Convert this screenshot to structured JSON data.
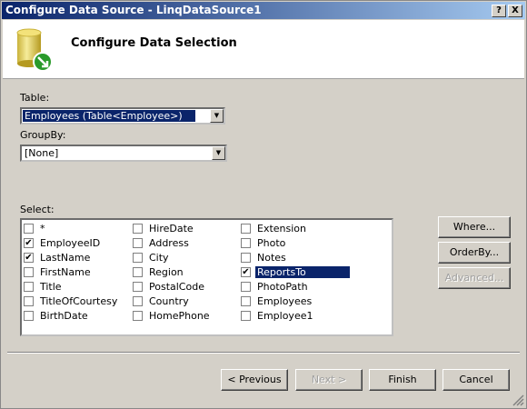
{
  "window": {
    "title": "Configure Data Source - LinqDataSource1",
    "help": "?",
    "close": "X"
  },
  "header": {
    "title": "Configure Data Selection"
  },
  "table": {
    "label": "Table:",
    "value": "Employees (Table<Employee>)"
  },
  "groupby": {
    "label": "GroupBy:",
    "value": "[None]"
  },
  "select": {
    "label": "Select:",
    "columns": [
      [
        {
          "name": "*",
          "checked": false
        },
        {
          "name": "EmployeeID",
          "checked": true
        },
        {
          "name": "LastName",
          "checked": true
        },
        {
          "name": "FirstName",
          "checked": false
        },
        {
          "name": "Title",
          "checked": false
        },
        {
          "name": "TitleOfCourtesy",
          "checked": false
        },
        {
          "name": "BirthDate",
          "checked": false
        }
      ],
      [
        {
          "name": "HireDate",
          "checked": false
        },
        {
          "name": "Address",
          "checked": false
        },
        {
          "name": "City",
          "checked": false
        },
        {
          "name": "Region",
          "checked": false
        },
        {
          "name": "PostalCode",
          "checked": false
        },
        {
          "name": "Country",
          "checked": false
        },
        {
          "name": "HomePhone",
          "checked": false
        }
      ],
      [
        {
          "name": "Extension",
          "checked": false
        },
        {
          "name": "Photo",
          "checked": false
        },
        {
          "name": "Notes",
          "checked": false
        },
        {
          "name": "ReportsTo",
          "checked": true,
          "selected": true
        },
        {
          "name": "PhotoPath",
          "checked": false
        },
        {
          "name": "Employees",
          "checked": false
        },
        {
          "name": "Employee1",
          "checked": false
        }
      ]
    ]
  },
  "side_buttons": {
    "where": "Where...",
    "orderby": "OrderBy...",
    "advanced": "Advanced..."
  },
  "footer": {
    "previous": "< Previous",
    "next": "Next >",
    "finish": "Finish",
    "cancel": "Cancel"
  }
}
